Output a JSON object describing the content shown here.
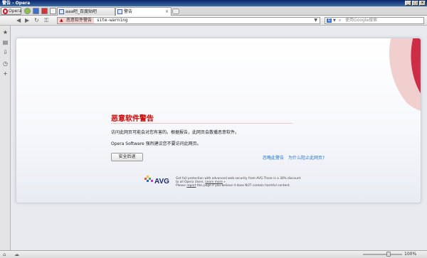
{
  "window": {
    "title": "警告 - Opera"
  },
  "tabs": {
    "opera_menu": "Opera",
    "items": [
      {
        "label": "aaa吧_百度贴吧"
      },
      {
        "label": "警告"
      }
    ]
  },
  "toolbar": {
    "badge_label": "恶意软件警告",
    "url": "site-warning",
    "search_engine": "G",
    "search_placeholder": "使用Google搜索"
  },
  "page": {
    "heading": "恶意软件警告",
    "paragraph1": "访问此网页可能会对您有害的。根据报告，此网页会散播恶意软件。",
    "paragraph2": "Opera Software 强烈建议您不要访问此网页。",
    "back_button": "安全后退",
    "ignore_link": "忽略此警告",
    "why_link": "为什么阻止此网页?",
    "avg_brand": "AVG",
    "avg_line1": "Get full protection with advanced web security from AVG.There is a 30% discount",
    "avg_line2a": "to all Opera Users. ",
    "avg_learn_more": "Learn more",
    "avg_line2b": " »",
    "avg_line3a": "Please ",
    "avg_report": "report",
    "avg_line3b": " this page if you believe it does NOT contain harmful content."
  },
  "statusbar": {
    "zoom": "100%"
  },
  "colors": {
    "heading": "#cc0000",
    "link": "#2277cc",
    "brand_red": "#c8102e"
  }
}
